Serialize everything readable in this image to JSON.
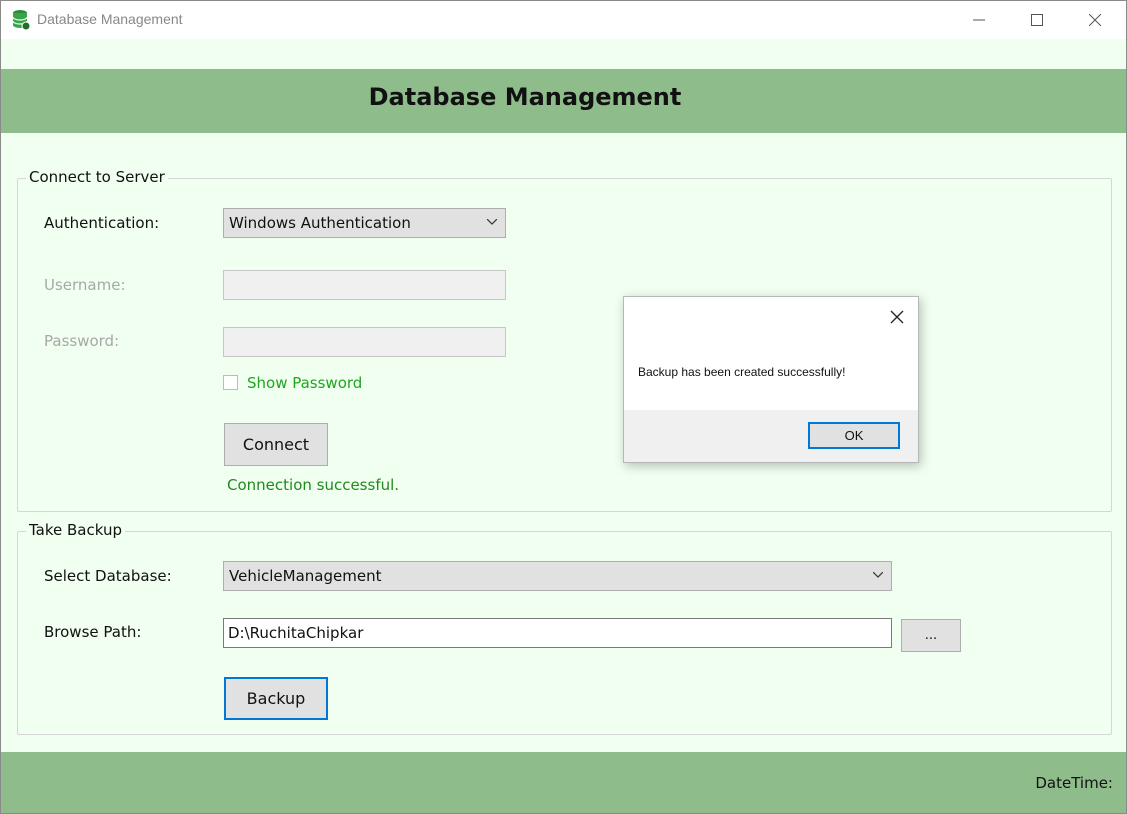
{
  "window": {
    "title": "Database Management",
    "icon": "database-icon",
    "controls": {
      "minimize": "minimize-icon",
      "maximize": "maximize-icon",
      "close": "close-icon"
    }
  },
  "header": {
    "title": "Database Management"
  },
  "connect": {
    "group_title": "Connect to Server",
    "auth_label": "Authentication:",
    "auth_value": "Windows Authentication",
    "username_label": "Username:",
    "username_value": "",
    "password_label": "Password:",
    "password_value": "",
    "show_password_label": "Show Password",
    "connect_button": "Connect",
    "status": "Connection successful."
  },
  "backup": {
    "group_title": "Take Backup",
    "db_label": "Select Database:",
    "db_value": "VehicleManagement",
    "path_label": "Browse Path:",
    "path_value": "D:\\RuchitaChipkar",
    "browse_button": "...",
    "backup_button": "Backup"
  },
  "footer": {
    "datetime_label": "DateTime:"
  },
  "dialog": {
    "message": "Backup has been created successfully!",
    "ok_button": "OK"
  },
  "colors": {
    "header_green": "#8fbc8b",
    "window_bg": "#f0fff0",
    "success_green": "#1e8b1e",
    "focus_blue": "#0078d7"
  }
}
